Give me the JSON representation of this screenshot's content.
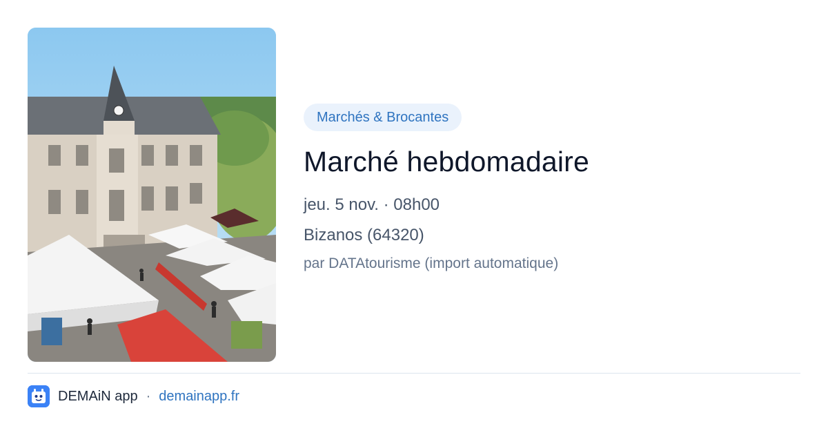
{
  "card": {
    "category": "Marchés & Brocantes",
    "title": "Marché hebdomadaire",
    "date": "jeu. 5 nov. · 08h00",
    "location": "Bizanos (64320)",
    "author": "par DATAtourisme (import automatique)"
  },
  "image": {
    "description_icon": "market-photo"
  },
  "footer": {
    "app_name": "DEMAiN app",
    "separator": "·",
    "site": "demainapp.fr",
    "icon": "demain-app-logo-icon"
  },
  "colors": {
    "chip_background": "#eaf2fc",
    "accent": "#2f74c0",
    "title": "#0f172a",
    "meta": "#475569"
  }
}
